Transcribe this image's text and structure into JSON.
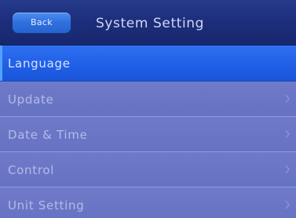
{
  "header": {
    "back_label": "Back",
    "title": "System Setting"
  },
  "menu": {
    "items": [
      {
        "label": "Language",
        "selected": true
      },
      {
        "label": "Update",
        "icon": "chevron-right-icon"
      },
      {
        "label": "Date & Time",
        "icon": "chevron-right-icon"
      },
      {
        "label": "Control",
        "icon": "chevron-right-icon"
      },
      {
        "label": "Unit Setting",
        "icon": "chevron-right-icon"
      }
    ]
  },
  "colors": {
    "header_bg": "#1d2f7c",
    "back_button": "#2f6fe0",
    "selected_row": "#1f5ee6",
    "row_bg": "#6c78c4",
    "row_text": "#b3bbe6"
  }
}
